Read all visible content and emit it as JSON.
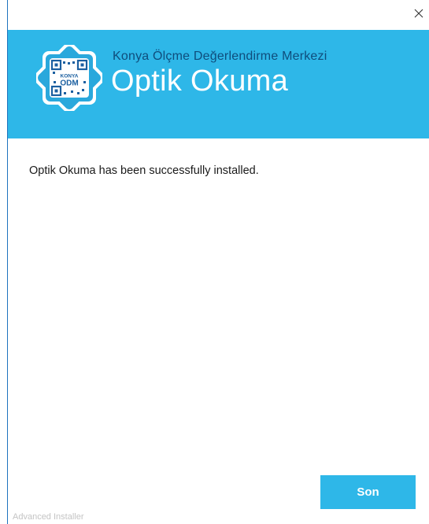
{
  "window": {
    "close_icon": "close-icon"
  },
  "banner": {
    "logo_text_top": "KONYA",
    "logo_text_bottom": "ODM",
    "subtitle": "Konya Ölçme Değerlendirme Merkezi",
    "title": "Optik Okuma",
    "background_color": "#2eb7e8"
  },
  "content": {
    "message": "Optik Okuma has been successfully installed."
  },
  "footer": {
    "brand": "Advanced Installer",
    "finish_label": "Son"
  }
}
